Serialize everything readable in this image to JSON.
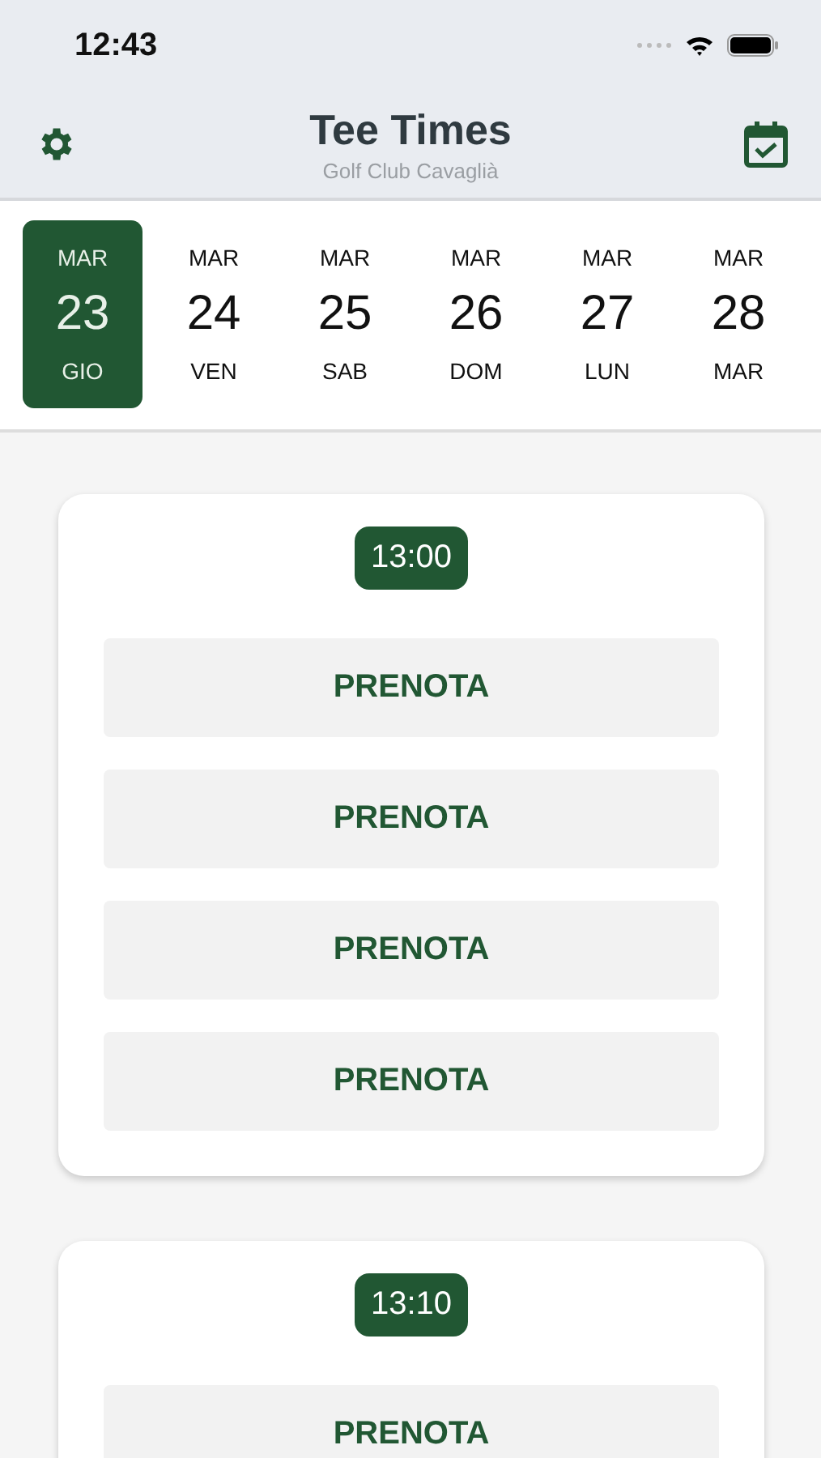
{
  "status_bar": {
    "time": "12:43"
  },
  "header": {
    "title": "Tee Times",
    "subtitle": "Golf Club Cavaglià"
  },
  "dates": [
    {
      "month": "MAR",
      "day": "23",
      "weekday": "GIO",
      "selected": true
    },
    {
      "month": "MAR",
      "day": "24",
      "weekday": "VEN",
      "selected": false
    },
    {
      "month": "MAR",
      "day": "25",
      "weekday": "SAB",
      "selected": false
    },
    {
      "month": "MAR",
      "day": "26",
      "weekday": "DOM",
      "selected": false
    },
    {
      "month": "MAR",
      "day": "27",
      "weekday": "LUN",
      "selected": false
    },
    {
      "month": "MAR",
      "day": "28",
      "weekday": "MAR",
      "selected": false
    }
  ],
  "tee_times": [
    {
      "time": "13:00",
      "buttons": [
        "PRENOTA",
        "PRENOTA",
        "PRENOTA",
        "PRENOTA"
      ]
    },
    {
      "time": "13:10",
      "buttons": [
        "PRENOTA"
      ]
    }
  ]
}
